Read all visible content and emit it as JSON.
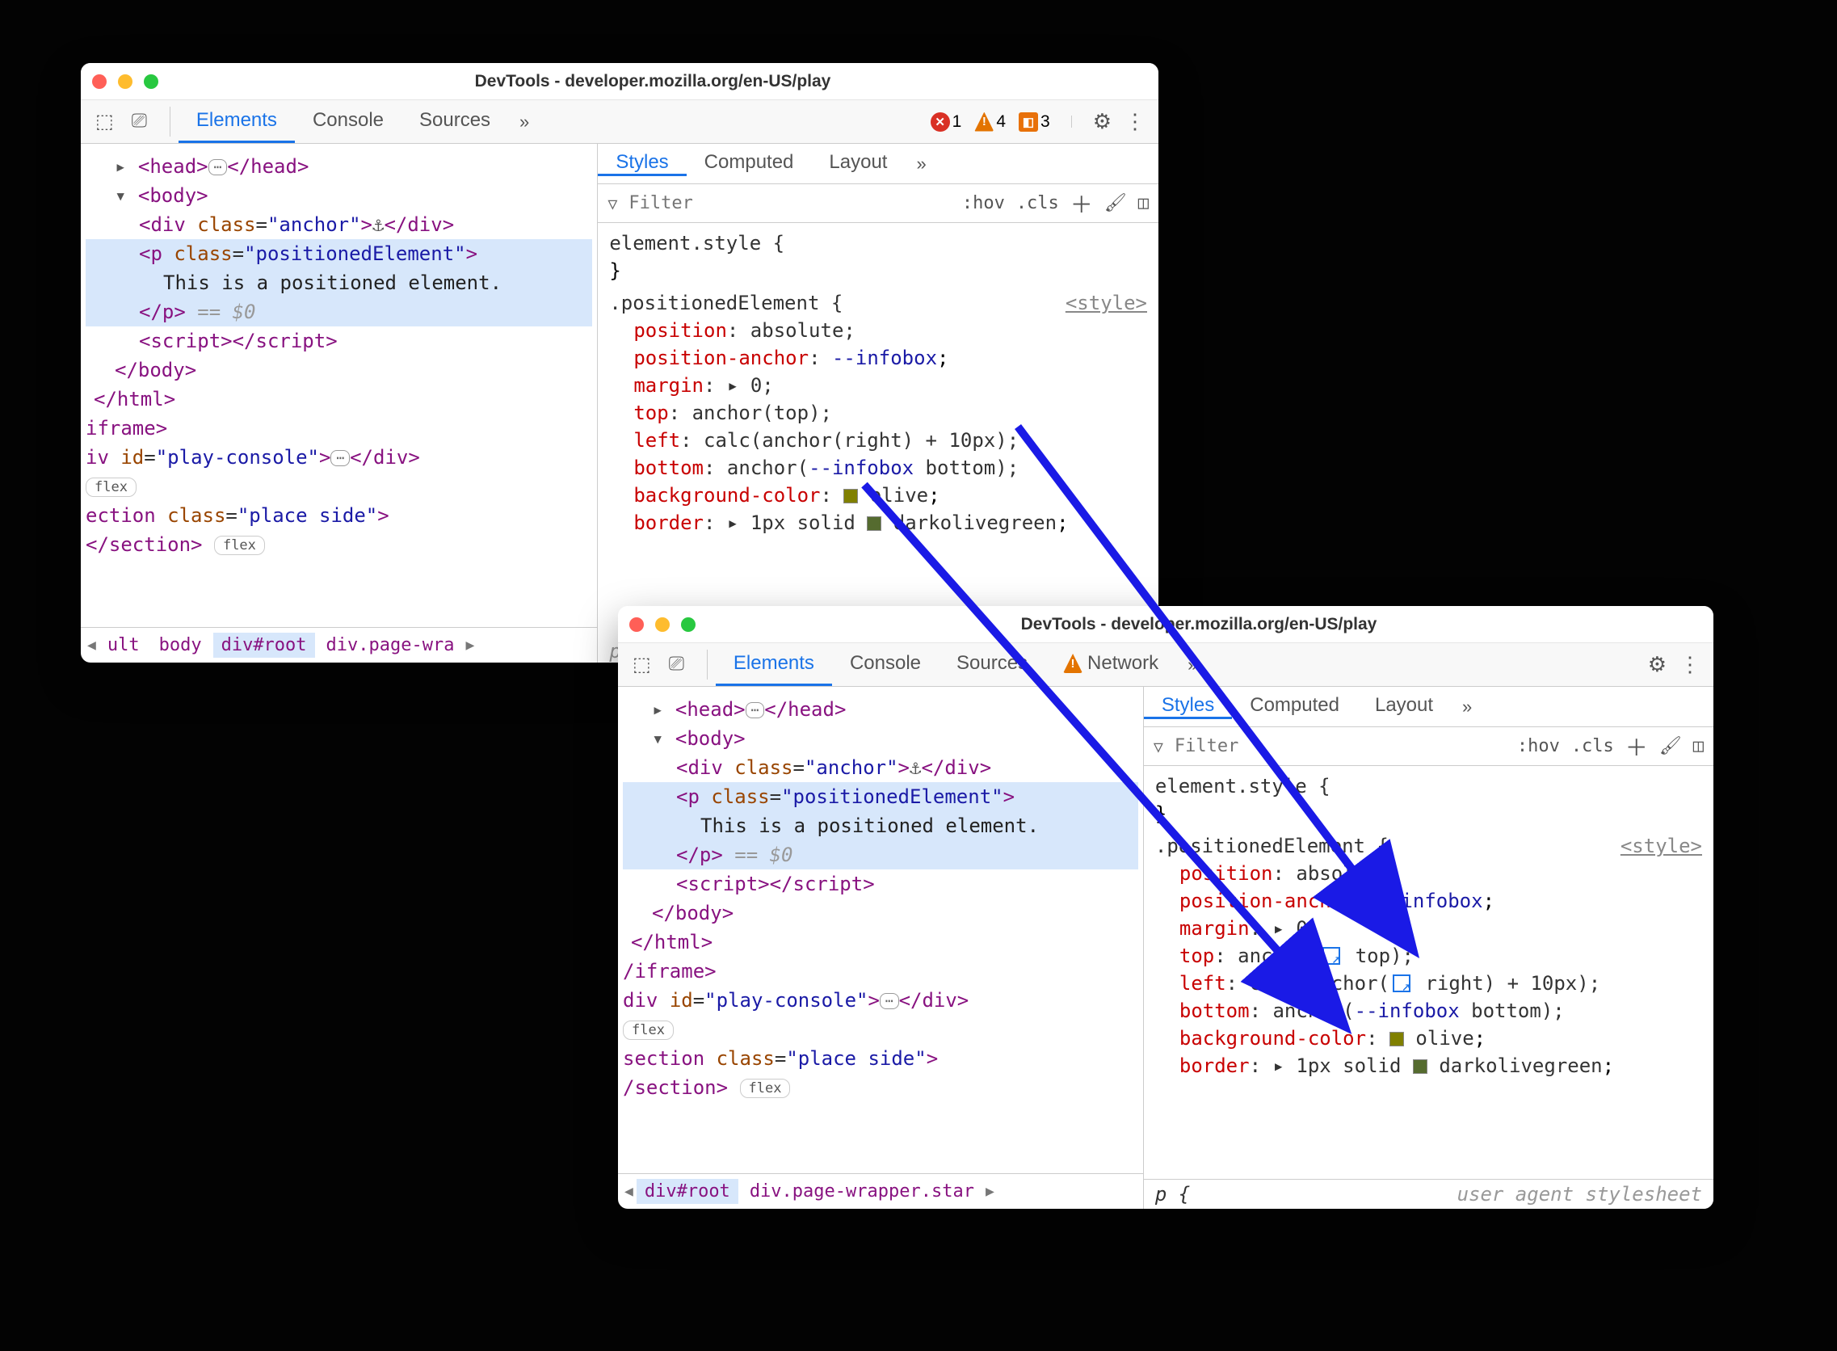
{
  "w1": {
    "title": "DevTools - developer.mozilla.org/en-US/play",
    "tabs": [
      "Elements",
      "Console",
      "Sources"
    ],
    "badges": {
      "errors": "1",
      "warnings": "4",
      "issues": "3"
    },
    "styles_tabs": [
      "Styles",
      "Computed",
      "Layout"
    ],
    "filter_placeholder": "Filter",
    "dom": {
      "head": "<head>",
      "head_close": "</head>",
      "body_open": "<body>",
      "div_open": "<div",
      "div_class_attr": "class",
      "div_class_val": "\"anchor\"",
      "div_open_end": ">",
      "div_anchor_emoji": "⚓︎",
      "div_close": "</div>",
      "p_open": "<p",
      "p_class_attr": "class",
      "p_class_val": "\"positionedElement\"",
      "p_open_end": ">",
      "p_text": "This is a positioned element.",
      "p_close": "</p>",
      "eq0": "== $0",
      "script": "<script>",
      "script_close": "</script>",
      "body_close": "</body>",
      "html_close": "</html>",
      "iframe_close": "iframe>",
      "play_div": "iv",
      "id_attr": "id",
      "id_val": "\"play-console\"",
      "div_gt": ">",
      "div_close2": "</div>",
      "flex": "flex",
      "section": "ection",
      "section_class_attr": "class",
      "section_class_val": "\"place side\"",
      "section_gt": ">",
      "section_close": "</section>",
      "flex2": "flex"
    },
    "breadcrumbs": [
      "ult",
      "body",
      "div#root",
      "div.page-wra"
    ],
    "css": {
      "element_style": "element.style {",
      "close": "}",
      "sel": ".positionedElement {",
      "src": "<style>",
      "r1": [
        "position",
        ": absolute;"
      ],
      "r2": [
        "position-anchor",
        ": ",
        "--infobox",
        ";"
      ],
      "r3": [
        "margin",
        ": ▸ 0;"
      ],
      "r4": [
        "top",
        ": anchor(top);"
      ],
      "r5": [
        "left",
        ": calc(anchor(right) + 10px);"
      ],
      "r6": [
        "bottom",
        ": anchor(",
        "--infobox",
        " bottom);"
      ],
      "r7": [
        "background-color",
        ": ",
        "olive",
        ";"
      ],
      "r8": [
        "border",
        ": ▸ 1px solid ",
        "darkolivegreen",
        ";"
      ]
    },
    "p_ital": "p"
  },
  "w2": {
    "title": "DevTools - developer.mozilla.org/en-US/play",
    "tabs": [
      "Elements",
      "Console",
      "Sources",
      "Network"
    ],
    "styles_tabs": [
      "Styles",
      "Computed",
      "Layout"
    ],
    "filter_placeholder": "Filter",
    "dom": {
      "head": "<head>",
      "head_close": "</head>",
      "body_open": "<body>",
      "div_open": "<div",
      "div_class_attr": "class",
      "div_class_val": "\"anchor\"",
      "div_open_end": ">",
      "div_anchor_emoji": "⚓︎",
      "div_close": "</div>",
      "p_open": "<p",
      "p_class_attr": "class",
      "p_class_val": "\"positionedElement\"",
      "p_open_end": ">",
      "p_text": "This is a positioned element.",
      "p_close": "</p>",
      "eq0": "== $0",
      "script": "<script>",
      "script_close": "</script>",
      "body_close": "</body>",
      "html_close": "</html>",
      "iframe_close": "/iframe>",
      "play_div": "div",
      "id_attr": "id",
      "id_val": "\"play-console\"",
      "div_gt": ">",
      "div_close2": "</div>",
      "flex": "flex",
      "section": "section",
      "section_class_attr": "class",
      "section_class_val": "\"place side\"",
      "section_gt": ">",
      "section_close_short": "/section>",
      "flex2": "flex"
    },
    "breadcrumbs": [
      "div#root",
      "div.page-wrapper.star"
    ],
    "css": {
      "element_style": "element.style {",
      "close": "}",
      "sel": ".positionedElement {",
      "src": "<style>",
      "r1": [
        "position",
        ": absolute;"
      ],
      "r2": [
        "position-anchor",
        ": ",
        "--infobox",
        ";"
      ],
      "r3": [
        "margin",
        ": ▸ 0;"
      ],
      "r4": [
        "top",
        ": anchor(",
        " top);"
      ],
      "r5": [
        "left",
        ": calc(anchor(",
        " right) + 10px);"
      ],
      "r6": [
        "bottom",
        ": anchor(",
        "--infobox",
        " bottom);"
      ],
      "r7": [
        "background-color",
        ": ",
        "olive",
        ";"
      ],
      "r8": [
        "border",
        ": ▸ 1px solid ",
        "darkolivegreen",
        ";"
      ],
      "p_rule": "p {",
      "uas": "user agent stylesheet"
    }
  },
  "hov": ":hov",
  "cls": ".cls"
}
